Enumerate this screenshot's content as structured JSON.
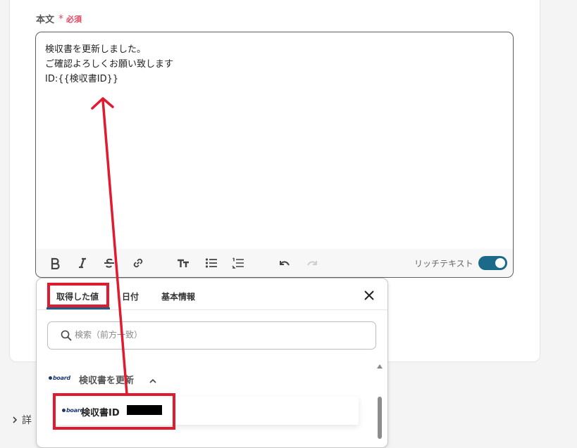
{
  "field": {
    "label": "本文",
    "required_mark": "*",
    "required_text": "必須"
  },
  "editor": {
    "lines": [
      "検収書を更新しました。",
      "ご確認よろしくお願い致します",
      "ID:{{検収書ID}}"
    ],
    "rich_text_label": "リッチテキスト",
    "rich_text_enabled": true
  },
  "dropdown": {
    "tabs": [
      {
        "label": "取得した値",
        "active": true
      },
      {
        "label": "日付",
        "active": false
      },
      {
        "label": "基本情報",
        "active": false
      }
    ],
    "search_placeholder": "検索（前方一致）",
    "group": {
      "label": "検収書を更新",
      "expanded": true
    },
    "item": {
      "label": "検収書ID"
    }
  },
  "brand": {
    "logo_text": "board"
  },
  "details_label": "詳",
  "colors": {
    "accent": "#1c6a8a",
    "required": "#e2445c",
    "annotation": "#e01a2f"
  }
}
